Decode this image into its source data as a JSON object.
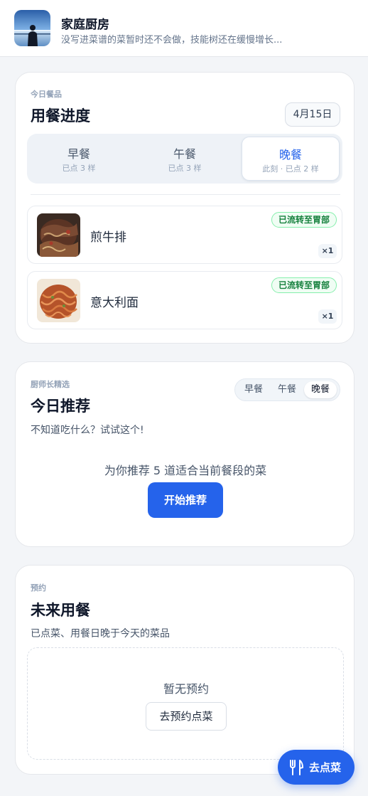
{
  "header": {
    "title": "家庭厨房",
    "subtitle": "没写进菜谱的菜暂时还不会做，技能树还在缓慢增长..."
  },
  "today": {
    "eyebrow": "今日餐品",
    "title": "用餐进度",
    "date": "4月15日",
    "meals": [
      {
        "name": "早餐",
        "sub": "已点 3 样",
        "active": false
      },
      {
        "name": "午餐",
        "sub": "已点 3 样",
        "active": false
      },
      {
        "name": "晚餐",
        "sub": "此刻 · 已点 2 样",
        "active": true
      }
    ],
    "dishes": [
      {
        "name": "煎牛排",
        "status": "已流转至胃部",
        "qty": "×1"
      },
      {
        "name": "意大利面",
        "status": "已流转至胃部",
        "qty": "×1"
      }
    ]
  },
  "recommend": {
    "eyebrow": "厨师长精选",
    "title": "今日推荐",
    "desc": "不知道吃什么？试试这个!",
    "segments": [
      "早餐",
      "午餐",
      "晚餐"
    ],
    "active_segment": "晚餐",
    "text": "为你推荐 5 道适合当前餐段的菜",
    "button": "开始推荐"
  },
  "reservation": {
    "eyebrow": "预约",
    "title": "未来用餐",
    "desc": "已点菜、用餐日晚于今天的菜品",
    "empty_text": "暂无预约",
    "button": "去预约点菜"
  },
  "fab": {
    "label": "去点菜",
    "icon": "fork-knife-icon"
  },
  "colors": {
    "accent": "#2563eb",
    "status_green": "#15803d"
  }
}
